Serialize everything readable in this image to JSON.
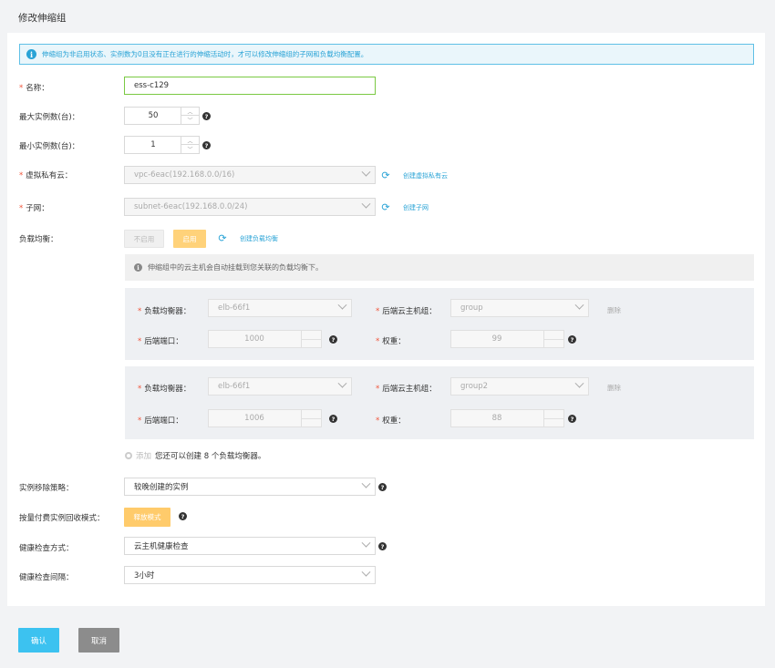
{
  "page_title": "修改伸缩组",
  "info_message": "伸缩组为非启用状态、实例数为0且没有正在进行的伸缩活动时，才可以修改伸缩组的子网和负载均衡配置。",
  "required_mark": "*",
  "form": {
    "name": {
      "label": "名称：",
      "value": "ess-c129"
    },
    "max_instances": {
      "label": "最大实例数(台)：",
      "value": "50"
    },
    "min_instances": {
      "label": "最小实例数(台)：",
      "value": "1"
    },
    "vpc": {
      "label": "虚拟私有云：",
      "value": "vpc-6eac(192.168.0.0/16)",
      "link": "创建虚拟私有云"
    },
    "subnet": {
      "label": "子网：",
      "value": "subnet-6eac(192.168.0.0/24)",
      "link": "创建子网"
    },
    "load_balance": {
      "label": "负载均衡：",
      "off_label": "不启用",
      "on_label": "启用",
      "link": "创建负载均衡",
      "note": "伸缩组中的云主机会自动挂载到您关联的负载均衡下。",
      "entries": [
        {
          "lb_label": "负载均衡器：",
          "lb_value": "elb-66f1",
          "group_label": "后端云主机组：",
          "group_value": "group",
          "delete": "删除",
          "port_label": "后端端口：",
          "port_value": "1000",
          "weight_label": "权重：",
          "weight_value": "99"
        },
        {
          "lb_label": "负载均衡器：",
          "lb_value": "elb-66f1",
          "group_label": "后端云主机组：",
          "group_value": "group2",
          "delete": "删除",
          "port_label": "后端端口：",
          "port_value": "1006",
          "weight_label": "权重：",
          "weight_value": "88"
        }
      ],
      "add_label": "添加",
      "add_hint": "您还可以创建 8 个负载均衡器。"
    },
    "removal_policy": {
      "label": "实例移除策略：",
      "value": "较晚创建的实例"
    },
    "recycle_mode": {
      "label": "按量付费实例回收模式：",
      "button": "释放模式"
    },
    "health_check": {
      "label": "健康检查方式：",
      "value": "云主机健康检查"
    },
    "health_interval": {
      "label": "健康检查间隔：",
      "value": "3小时"
    }
  },
  "footer": {
    "confirm": "确认",
    "cancel": "取消"
  },
  "colors": {
    "accent": "#29a3d6",
    "warning": "#ffcb6b",
    "required": "#f0543a",
    "confirm": "#3cc2f0",
    "cancel": "#8c8c8c"
  }
}
